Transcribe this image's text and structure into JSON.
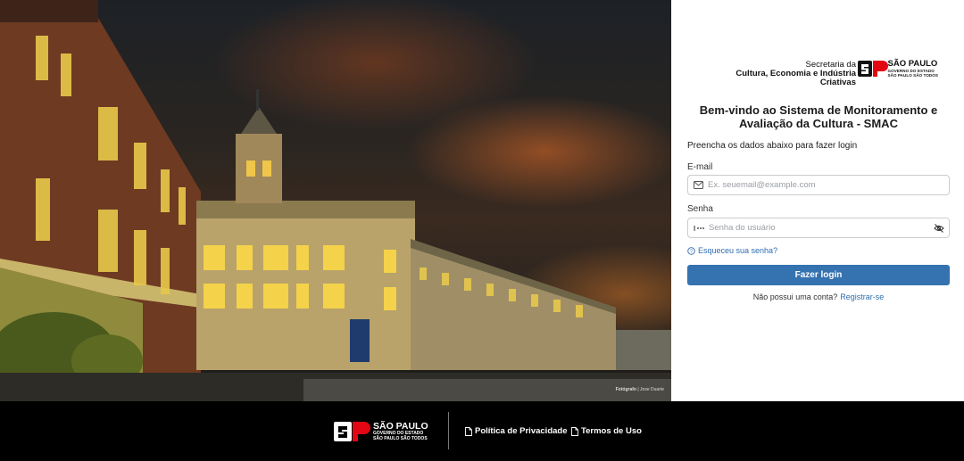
{
  "hero": {
    "photo_credit_label": "Fotógrafo",
    "photo_credit_name": "| Jose Duarte"
  },
  "branding": {
    "secretaria_line1": "Secretaria da",
    "secretaria_line2": "Cultura, Economia e Indústria Criativas",
    "sp_title": "SÃO PAULO",
    "sp_sub1": "GOVERNO DO ESTADO",
    "sp_sub2": "SÃO PAULO SÃO TODOS"
  },
  "login": {
    "welcome": "Bem-vindo ao Sistema de Monitoramento e Avaliação da Cultura - SMAC",
    "instructions": "Preencha os dados abaixo para fazer login",
    "email_label": "E-mail",
    "email_placeholder": "Ex. seuemail@example.com",
    "email_value": "",
    "password_label": "Senha",
    "password_placeholder": "Senha do usuário",
    "password_value": "",
    "forgot_password": "Esqueceu sua senha?",
    "submit_label": "Fazer login",
    "no_account": "Não possui uma conta?",
    "register_link": "Registrar-se"
  },
  "footer": {
    "sp_title": "SÃO PAULO",
    "sp_sub1": "GOVERNO DO ESTADO",
    "sp_sub2": "SÃO PAULO SÃO TODOS",
    "privacy_link": "Política de Privacidade",
    "terms_link": "Termos de Uso"
  },
  "colors": {
    "primary": "#3572b0",
    "link": "#2f6db0",
    "brand_red": "#e30613",
    "footer_bg": "#000000"
  },
  "icons": {
    "email": "envelope-icon",
    "password": "key-icon",
    "toggle_visibility": "eye-off-icon",
    "forgot": "question-circle-icon",
    "document": "document-icon"
  }
}
